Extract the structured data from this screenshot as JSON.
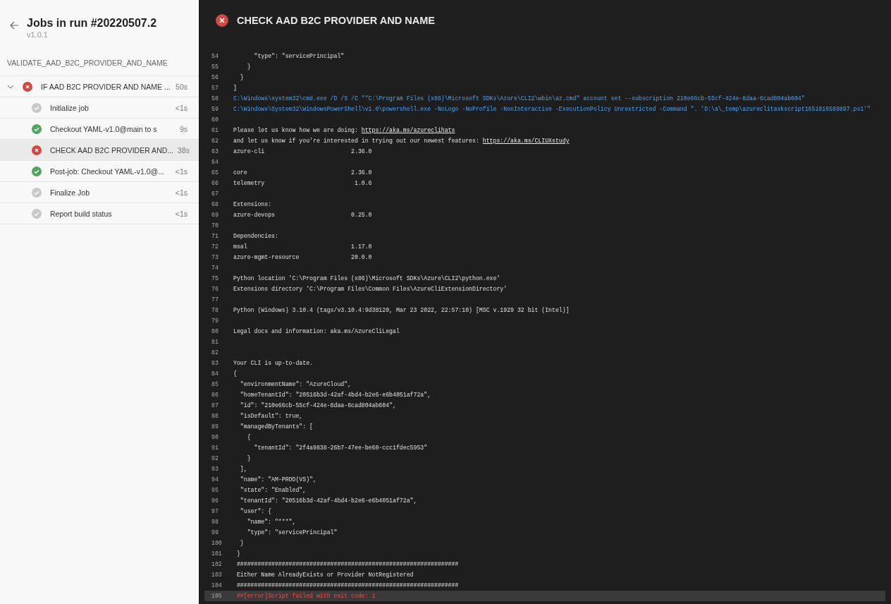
{
  "sidebar": {
    "title": "Jobs in run #20220507.2",
    "version": "v1.0.1",
    "stage": "VALIDATE_AAD_B2C_PROVIDER_AND_NAME",
    "jobs": [
      {
        "name": "IF AAD B2C PROVIDER AND NAME ...",
        "duration": "50s",
        "kind": "failed",
        "expanded": true,
        "selected": false,
        "children": [
          {
            "name": "Initialize job",
            "duration": "<1s",
            "kind": "skipped",
            "selected": false
          },
          {
            "name": "Checkout YAML-v1.0@main to s",
            "duration": "9s",
            "kind": "succeeded",
            "selected": false
          },
          {
            "name": "CHECK AAD B2C PROVIDER AND...",
            "duration": "38s",
            "kind": "failed",
            "selected": true
          },
          {
            "name": "Post-job: Checkout YAML-v1.0@...",
            "duration": "<1s",
            "kind": "succeeded",
            "selected": false
          },
          {
            "name": "Finalize Job",
            "duration": "<1s",
            "kind": "skipped",
            "selected": false
          },
          {
            "name": "Report build status",
            "duration": "<1s",
            "kind": "skipped",
            "selected": false
          }
        ]
      }
    ]
  },
  "log": {
    "title": "CHECK AAD B2C PROVIDER AND NAME",
    "kind": "failed",
    "lines": [
      {
        "number": "54",
        "kind": "normal",
        "text": "      \"type\": \"servicePrincipal\""
      },
      {
        "number": "55",
        "kind": "normal",
        "text": "    }"
      },
      {
        "number": "56",
        "kind": "normal",
        "text": "  }"
      },
      {
        "number": "57",
        "kind": "normal",
        "text": "]"
      },
      {
        "number": "58",
        "kind": "command",
        "text": "C:\\Windows\\system32\\cmd.exe /D /S /C \"\"C:\\Program Files (x86)\\Microsoft SDKs\\Azure\\CLI2\\wbin\\az.cmd\" account set --subscription 210e66cb-55cf-424e-8daa-6cad804ab604\""
      },
      {
        "number": "59",
        "kind": "command",
        "text": "C:\\Windows\\System32\\WindowsPowerShell\\v1.0\\powershell.exe -NoLogo -NoProfile -NonInteractive -ExecutionPolicy Unrestricted -Command \". 'D:\\a\\_temp\\azureclitaskscript1651916589897.ps1'\""
      },
      {
        "number": "60",
        "kind": "normal"
      },
      {
        "number": "61",
        "kind": "normal",
        "text": "Please let us know how we are doing: ",
        "link": "https://aka.ms/azureclihats"
      },
      {
        "number": "62",
        "kind": "normal",
        "text": "and let us know if you're interested in trying out our newest features: ",
        "link": "https://aka.ms/CLIUXstudy"
      },
      {
        "number": "63",
        "kind": "normal",
        "text": "azure-cli                         2.36.0"
      },
      {
        "number": "64",
        "kind": "normal"
      },
      {
        "number": "65",
        "kind": "normal",
        "text": "core                              2.36.0"
      },
      {
        "number": "66",
        "kind": "normal",
        "text": "telemetry                          1.0.6"
      },
      {
        "number": "67",
        "kind": "normal"
      },
      {
        "number": "68",
        "kind": "normal",
        "text": "Extensions:"
      },
      {
        "number": "69",
        "kind": "normal",
        "text": "azure-devops                      0.25.0"
      },
      {
        "number": "70",
        "kind": "normal"
      },
      {
        "number": "71",
        "kind": "normal",
        "text": "Dependencies:"
      },
      {
        "number": "72",
        "kind": "normal",
        "text": "msal                              1.17.0"
      },
      {
        "number": "73",
        "kind": "normal",
        "text": "azure-mgmt-resource               20.0.0"
      },
      {
        "number": "74",
        "kind": "normal"
      },
      {
        "number": "75",
        "kind": "normal",
        "text": "Python location 'C:\\Program Files (x86)\\Microsoft SDKs\\Azure\\CLI2\\python.exe'"
      },
      {
        "number": "76",
        "kind": "normal",
        "text": "Extensions directory 'C:\\Program Files\\Common Files\\AzureCliExtensionDirectory'"
      },
      {
        "number": "77",
        "kind": "normal"
      },
      {
        "number": "78",
        "kind": "normal",
        "text": "Python (Windows) 3.10.4 (tags/v3.10.4:9d38120, Mar 23 2022, 22:57:10) [MSC v.1929 32 bit (Intel)]"
      },
      {
        "number": "79",
        "kind": "normal"
      },
      {
        "number": "80",
        "kind": "normal",
        "text": "Legal docs and information: aka.ms/AzureCliLegal"
      },
      {
        "number": "81",
        "kind": "normal"
      },
      {
        "number": "82",
        "kind": "normal"
      },
      {
        "number": "83",
        "kind": "normal",
        "text": "Your CLI is up-to-date."
      },
      {
        "number": "84",
        "kind": "normal",
        "text": "{"
      },
      {
        "number": "85",
        "kind": "normal",
        "text": "  \"environmentName\": \"AzureCloud\","
      },
      {
        "number": "86",
        "kind": "normal",
        "text": "  \"homeTenantId\": \"20516b3d-42af-4bd4-b2e6-e6b4051af72a\","
      },
      {
        "number": "87",
        "kind": "normal",
        "text": "  \"id\": \"210e66cb-55cf-424e-8daa-6cad804ab604\","
      },
      {
        "number": "88",
        "kind": "normal",
        "text": "  \"isDefault\": true,"
      },
      {
        "number": "89",
        "kind": "normal",
        "text": "  \"managedByTenants\": ["
      },
      {
        "number": "90",
        "kind": "normal",
        "text": "    {"
      },
      {
        "number": "91",
        "kind": "normal",
        "text": "      \"tenantId\": \"2f4a9838-26b7-47ee-be60-ccc1fdec5953\""
      },
      {
        "number": "92",
        "kind": "normal",
        "text": "    }"
      },
      {
        "number": "93",
        "kind": "normal",
        "text": "  ],"
      },
      {
        "number": "94",
        "kind": "normal",
        "text": "  \"name\": \"AM-PROD(VS)\","
      },
      {
        "number": "95",
        "kind": "normal",
        "text": "  \"state\": \"Enabled\","
      },
      {
        "number": "96",
        "kind": "normal",
        "text": "  \"tenantId\": \"20516b3d-42af-4bd4-b2e6-e6b4051af72a\","
      },
      {
        "number": "97",
        "kind": "normal",
        "text": "  \"user\": {"
      },
      {
        "number": "98",
        "kind": "normal",
        "text": "    \"name\": \"***\","
      },
      {
        "number": "99",
        "kind": "normal",
        "text": "    \"type\": \"servicePrincipal\""
      },
      {
        "number": "100",
        "kind": "normal",
        "text": "  }"
      },
      {
        "number": "101",
        "kind": "normal",
        "text": " }"
      },
      {
        "number": "102",
        "kind": "normal",
        "text": " ################################################################"
      },
      {
        "number": "103",
        "kind": "normal",
        "text": " Either Name AlreadyExists or Provider NotRegistered"
      },
      {
        "number": "104",
        "kind": "normal",
        "text": " ################################################################"
      },
      {
        "number": "105",
        "kind": "error",
        "text": " ##[error]Script failed with exit code: 1"
      }
    ]
  }
}
